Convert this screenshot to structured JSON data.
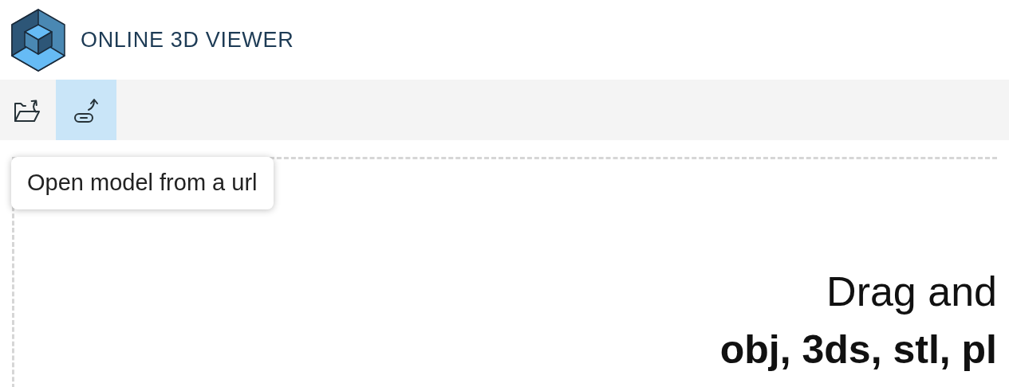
{
  "header": {
    "title": "ONLINE 3D VIEWER"
  },
  "toolbar": {
    "buttons": [
      {
        "kind": "open-file",
        "selected": false
      },
      {
        "kind": "open-url",
        "selected": true
      }
    ]
  },
  "tooltip": {
    "text": "Open model from a url"
  },
  "drop_area": {
    "lines": [
      "Drag and",
      "obj, 3ds, stl, pl"
    ]
  }
}
